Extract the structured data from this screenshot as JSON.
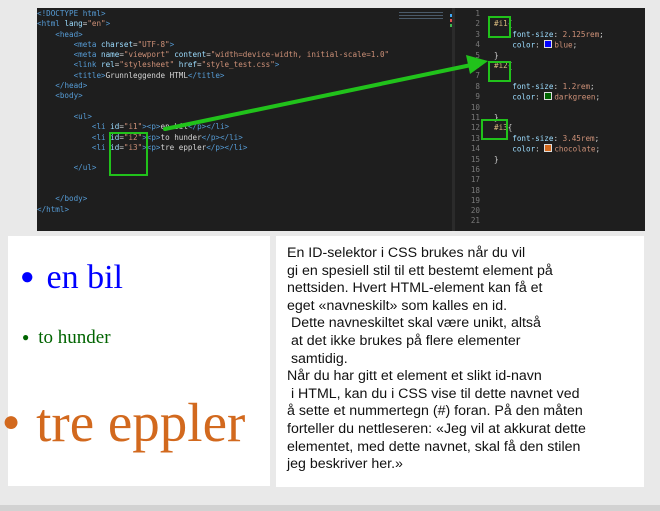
{
  "html_editor": {
    "lines": [
      [
        {
          "t": "<!DOCTYPE ",
          "c": "tag"
        },
        {
          "t": "html",
          "c": "tag"
        },
        {
          "t": ">",
          "c": "tag"
        }
      ],
      [
        {
          "t": "<",
          "c": "tag"
        },
        {
          "t": "html ",
          "c": "tag"
        },
        {
          "t": "lang",
          "c": "att"
        },
        {
          "t": "=",
          "c": "pun"
        },
        {
          "t": "\"en\"",
          "c": "str"
        },
        {
          "t": ">",
          "c": "tag"
        }
      ],
      [
        {
          "t": "    <",
          "c": "tag"
        },
        {
          "t": "head",
          "c": "tag"
        },
        {
          "t": ">",
          "c": "tag"
        }
      ],
      [
        {
          "t": "        <",
          "c": "tag"
        },
        {
          "t": "meta ",
          "c": "tag"
        },
        {
          "t": "charset",
          "c": "att"
        },
        {
          "t": "=",
          "c": "pun"
        },
        {
          "t": "\"UTF-8\"",
          "c": "str"
        },
        {
          "t": ">",
          "c": "tag"
        }
      ],
      [
        {
          "t": "        <",
          "c": "tag"
        },
        {
          "t": "meta ",
          "c": "tag"
        },
        {
          "t": "name",
          "c": "att"
        },
        {
          "t": "=",
          "c": "pun"
        },
        {
          "t": "\"viewport\" ",
          "c": "str"
        },
        {
          "t": "content",
          "c": "att"
        },
        {
          "t": "=",
          "c": "pun"
        },
        {
          "t": "\"width=device-width, initial-scale=1.0\"",
          "c": "str"
        }
      ],
      [
        {
          "t": "        <",
          "c": "tag"
        },
        {
          "t": "link ",
          "c": "tag"
        },
        {
          "t": "rel",
          "c": "att"
        },
        {
          "t": "=",
          "c": "pun"
        },
        {
          "t": "\"stylesheet\" ",
          "c": "str"
        },
        {
          "t": "href",
          "c": "att"
        },
        {
          "t": "=",
          "c": "pun"
        },
        {
          "t": "\"style_test.css\"",
          "c": "str"
        },
        {
          "t": ">",
          "c": "tag"
        }
      ],
      [
        {
          "t": "        <",
          "c": "tag"
        },
        {
          "t": "title",
          "c": "tag"
        },
        {
          "t": ">",
          "c": "tag"
        },
        {
          "t": "Grunnleggende HTML",
          "c": "txt"
        },
        {
          "t": "</",
          "c": "tag"
        },
        {
          "t": "title",
          "c": "tag"
        },
        {
          "t": ">",
          "c": "tag"
        }
      ],
      [
        {
          "t": "    </",
          "c": "tag"
        },
        {
          "t": "head",
          "c": "tag"
        },
        {
          "t": ">",
          "c": "tag"
        }
      ],
      [
        {
          "t": "    <",
          "c": "tag"
        },
        {
          "t": "body",
          "c": "tag"
        },
        {
          "t": ">",
          "c": "tag"
        }
      ],
      [
        {
          "t": "",
          "c": "txt"
        }
      ],
      [
        {
          "t": "        <",
          "c": "tag"
        },
        {
          "t": "ul",
          "c": "tag"
        },
        {
          "t": ">",
          "c": "tag"
        }
      ],
      [
        {
          "t": "            <",
          "c": "tag"
        },
        {
          "t": "li ",
          "c": "tag"
        },
        {
          "t": "id",
          "c": "att"
        },
        {
          "t": "=",
          "c": "pun"
        },
        {
          "t": "\"i1\"",
          "c": "str"
        },
        {
          "t": "><",
          "c": "tag"
        },
        {
          "t": "p",
          "c": "tag"
        },
        {
          "t": ">",
          "c": "tag"
        },
        {
          "t": "en bil",
          "c": "txt"
        },
        {
          "t": "</",
          "c": "tag"
        },
        {
          "t": "p",
          "c": "tag"
        },
        {
          "t": "></",
          "c": "tag"
        },
        {
          "t": "li",
          "c": "tag"
        },
        {
          "t": ">",
          "c": "tag"
        }
      ],
      [
        {
          "t": "            <",
          "c": "tag"
        },
        {
          "t": "li ",
          "c": "tag"
        },
        {
          "t": "id",
          "c": "att"
        },
        {
          "t": "=",
          "c": "pun"
        },
        {
          "t": "\"i2\"",
          "c": "str"
        },
        {
          "t": "><",
          "c": "tag"
        },
        {
          "t": "p",
          "c": "tag"
        },
        {
          "t": ">",
          "c": "tag"
        },
        {
          "t": "to hunder",
          "c": "txt"
        },
        {
          "t": "</",
          "c": "tag"
        },
        {
          "t": "p",
          "c": "tag"
        },
        {
          "t": "></",
          "c": "tag"
        },
        {
          "t": "li",
          "c": "tag"
        },
        {
          "t": ">",
          "c": "tag"
        }
      ],
      [
        {
          "t": "            <",
          "c": "tag"
        },
        {
          "t": "li ",
          "c": "tag"
        },
        {
          "t": "id",
          "c": "att"
        },
        {
          "t": "=",
          "c": "pun"
        },
        {
          "t": "\"i3\"",
          "c": "str"
        },
        {
          "t": "><",
          "c": "tag"
        },
        {
          "t": "p",
          "c": "tag"
        },
        {
          "t": ">",
          "c": "tag"
        },
        {
          "t": "tre eppler",
          "c": "txt"
        },
        {
          "t": "</",
          "c": "tag"
        },
        {
          "t": "p",
          "c": "tag"
        },
        {
          "t": "></",
          "c": "tag"
        },
        {
          "t": "li",
          "c": "tag"
        },
        {
          "t": ">",
          "c": "tag"
        }
      ],
      [
        {
          "t": "",
          "c": "txt"
        }
      ],
      [
        {
          "t": "        </",
          "c": "tag"
        },
        {
          "t": "ul",
          "c": "tag"
        },
        {
          "t": ">",
          "c": "tag"
        }
      ],
      [
        {
          "t": "",
          "c": "txt"
        }
      ],
      [
        {
          "t": "",
          "c": "txt"
        }
      ],
      [
        {
          "t": "    </",
          "c": "tag"
        },
        {
          "t": "body",
          "c": "tag"
        },
        {
          "t": ">",
          "c": "tag"
        }
      ],
      [
        {
          "t": "</",
          "c": "tag"
        },
        {
          "t": "html",
          "c": "tag"
        },
        {
          "t": ">",
          "c": "tag"
        }
      ]
    ]
  },
  "css_editor": {
    "lines": [
      {
        "n": "1",
        "parts": []
      },
      {
        "n": "2",
        "parts": [
          {
            "t": "#i1",
            "c": "sel"
          },
          {
            "t": "{",
            "c": "pun"
          }
        ]
      },
      {
        "n": "3",
        "parts": [
          {
            "t": "    font-size",
            "c": "prop"
          },
          {
            "t": ": ",
            "c": "pun"
          },
          {
            "t": "2.125rem",
            "c": "val"
          },
          {
            "t": ";",
            "c": "pun"
          }
        ]
      },
      {
        "n": "4",
        "parts": [
          {
            "t": "    color",
            "c": "prop"
          },
          {
            "t": ": ",
            "c": "pun"
          },
          {
            "swatch": "#0000ff"
          },
          {
            "t": "blue",
            "c": "val"
          },
          {
            "t": ";",
            "c": "pun"
          }
        ]
      },
      {
        "n": "5",
        "parts": [
          {
            "t": "}",
            "c": "pun"
          }
        ]
      },
      {
        "n": "6",
        "parts": [
          {
            "t": "#i2",
            "c": "sel"
          },
          {
            "t": "{",
            "c": "pun"
          }
        ]
      },
      {
        "n": "7",
        "parts": []
      },
      {
        "n": "8",
        "parts": [
          {
            "t": "    font-size",
            "c": "prop"
          },
          {
            "t": ": ",
            "c": "pun"
          },
          {
            "t": "1.2rem",
            "c": "val"
          },
          {
            "t": ";",
            "c": "pun"
          }
        ]
      },
      {
        "n": "9",
        "parts": [
          {
            "t": "    color",
            "c": "prop"
          },
          {
            "t": ": ",
            "c": "pun"
          },
          {
            "swatch": "#006400"
          },
          {
            "t": "darkgreen",
            "c": "val"
          },
          {
            "t": ";",
            "c": "pun"
          }
        ]
      },
      {
        "n": "10",
        "parts": []
      },
      {
        "n": "11",
        "parts": [
          {
            "t": "}",
            "c": "pun"
          }
        ]
      },
      {
        "n": "12",
        "parts": [
          {
            "t": "#i3",
            "c": "sel"
          },
          {
            "t": "{",
            "c": "pun"
          }
        ]
      },
      {
        "n": "13",
        "parts": [
          {
            "t": "    font-size",
            "c": "prop"
          },
          {
            "t": ": ",
            "c": "pun"
          },
          {
            "t": "3.45rem",
            "c": "val"
          },
          {
            "t": ";",
            "c": "pun"
          }
        ]
      },
      {
        "n": "14",
        "parts": [
          {
            "t": "    color",
            "c": "prop"
          },
          {
            "t": ": ",
            "c": "pun"
          },
          {
            "swatch": "#d2691e"
          },
          {
            "t": "chocolate",
            "c": "val"
          },
          {
            "t": ";",
            "c": "pun"
          }
        ]
      },
      {
        "n": "15",
        "parts": [
          {
            "t": "}",
            "c": "pun"
          }
        ]
      },
      {
        "n": "16",
        "parts": []
      },
      {
        "n": "17",
        "parts": []
      },
      {
        "n": "18",
        "parts": []
      },
      {
        "n": "19",
        "parts": []
      },
      {
        "n": "20",
        "parts": []
      },
      {
        "n": "21",
        "parts": []
      }
    ]
  },
  "rendered": {
    "items": [
      {
        "text": "en bil",
        "color": "#0000ff"
      },
      {
        "text": "to hunder",
        "color": "#006400"
      },
      {
        "text": "tre eppler",
        "color": "#d2691e"
      }
    ]
  },
  "explanation": {
    "text": "En ID-selektor i CSS brukes når du vil\ngi en spesiell stil til ett bestemt element på\nnettsiden. Hvert HTML-element kan få et\neget «navneskilt» som kalles en id.\n Dette navneskiltet skal være unikt, altså\n at det ikke brukes på flere elementer\n samtidig.\nNår du har gitt et element et slikt id-navn\n i HTML, kan du i CSS vise til dette navnet ved\nå sette et nummertegn (#) foran. På den måten\nforteller du nettleseren: «Jeg vil at akkurat dette\nelementet, med dette navnet, skal få den stilen\njeg beskriver her.»"
  },
  "colors": {
    "highlight": "#21c21b",
    "editor_bg": "#1e1e1e"
  }
}
